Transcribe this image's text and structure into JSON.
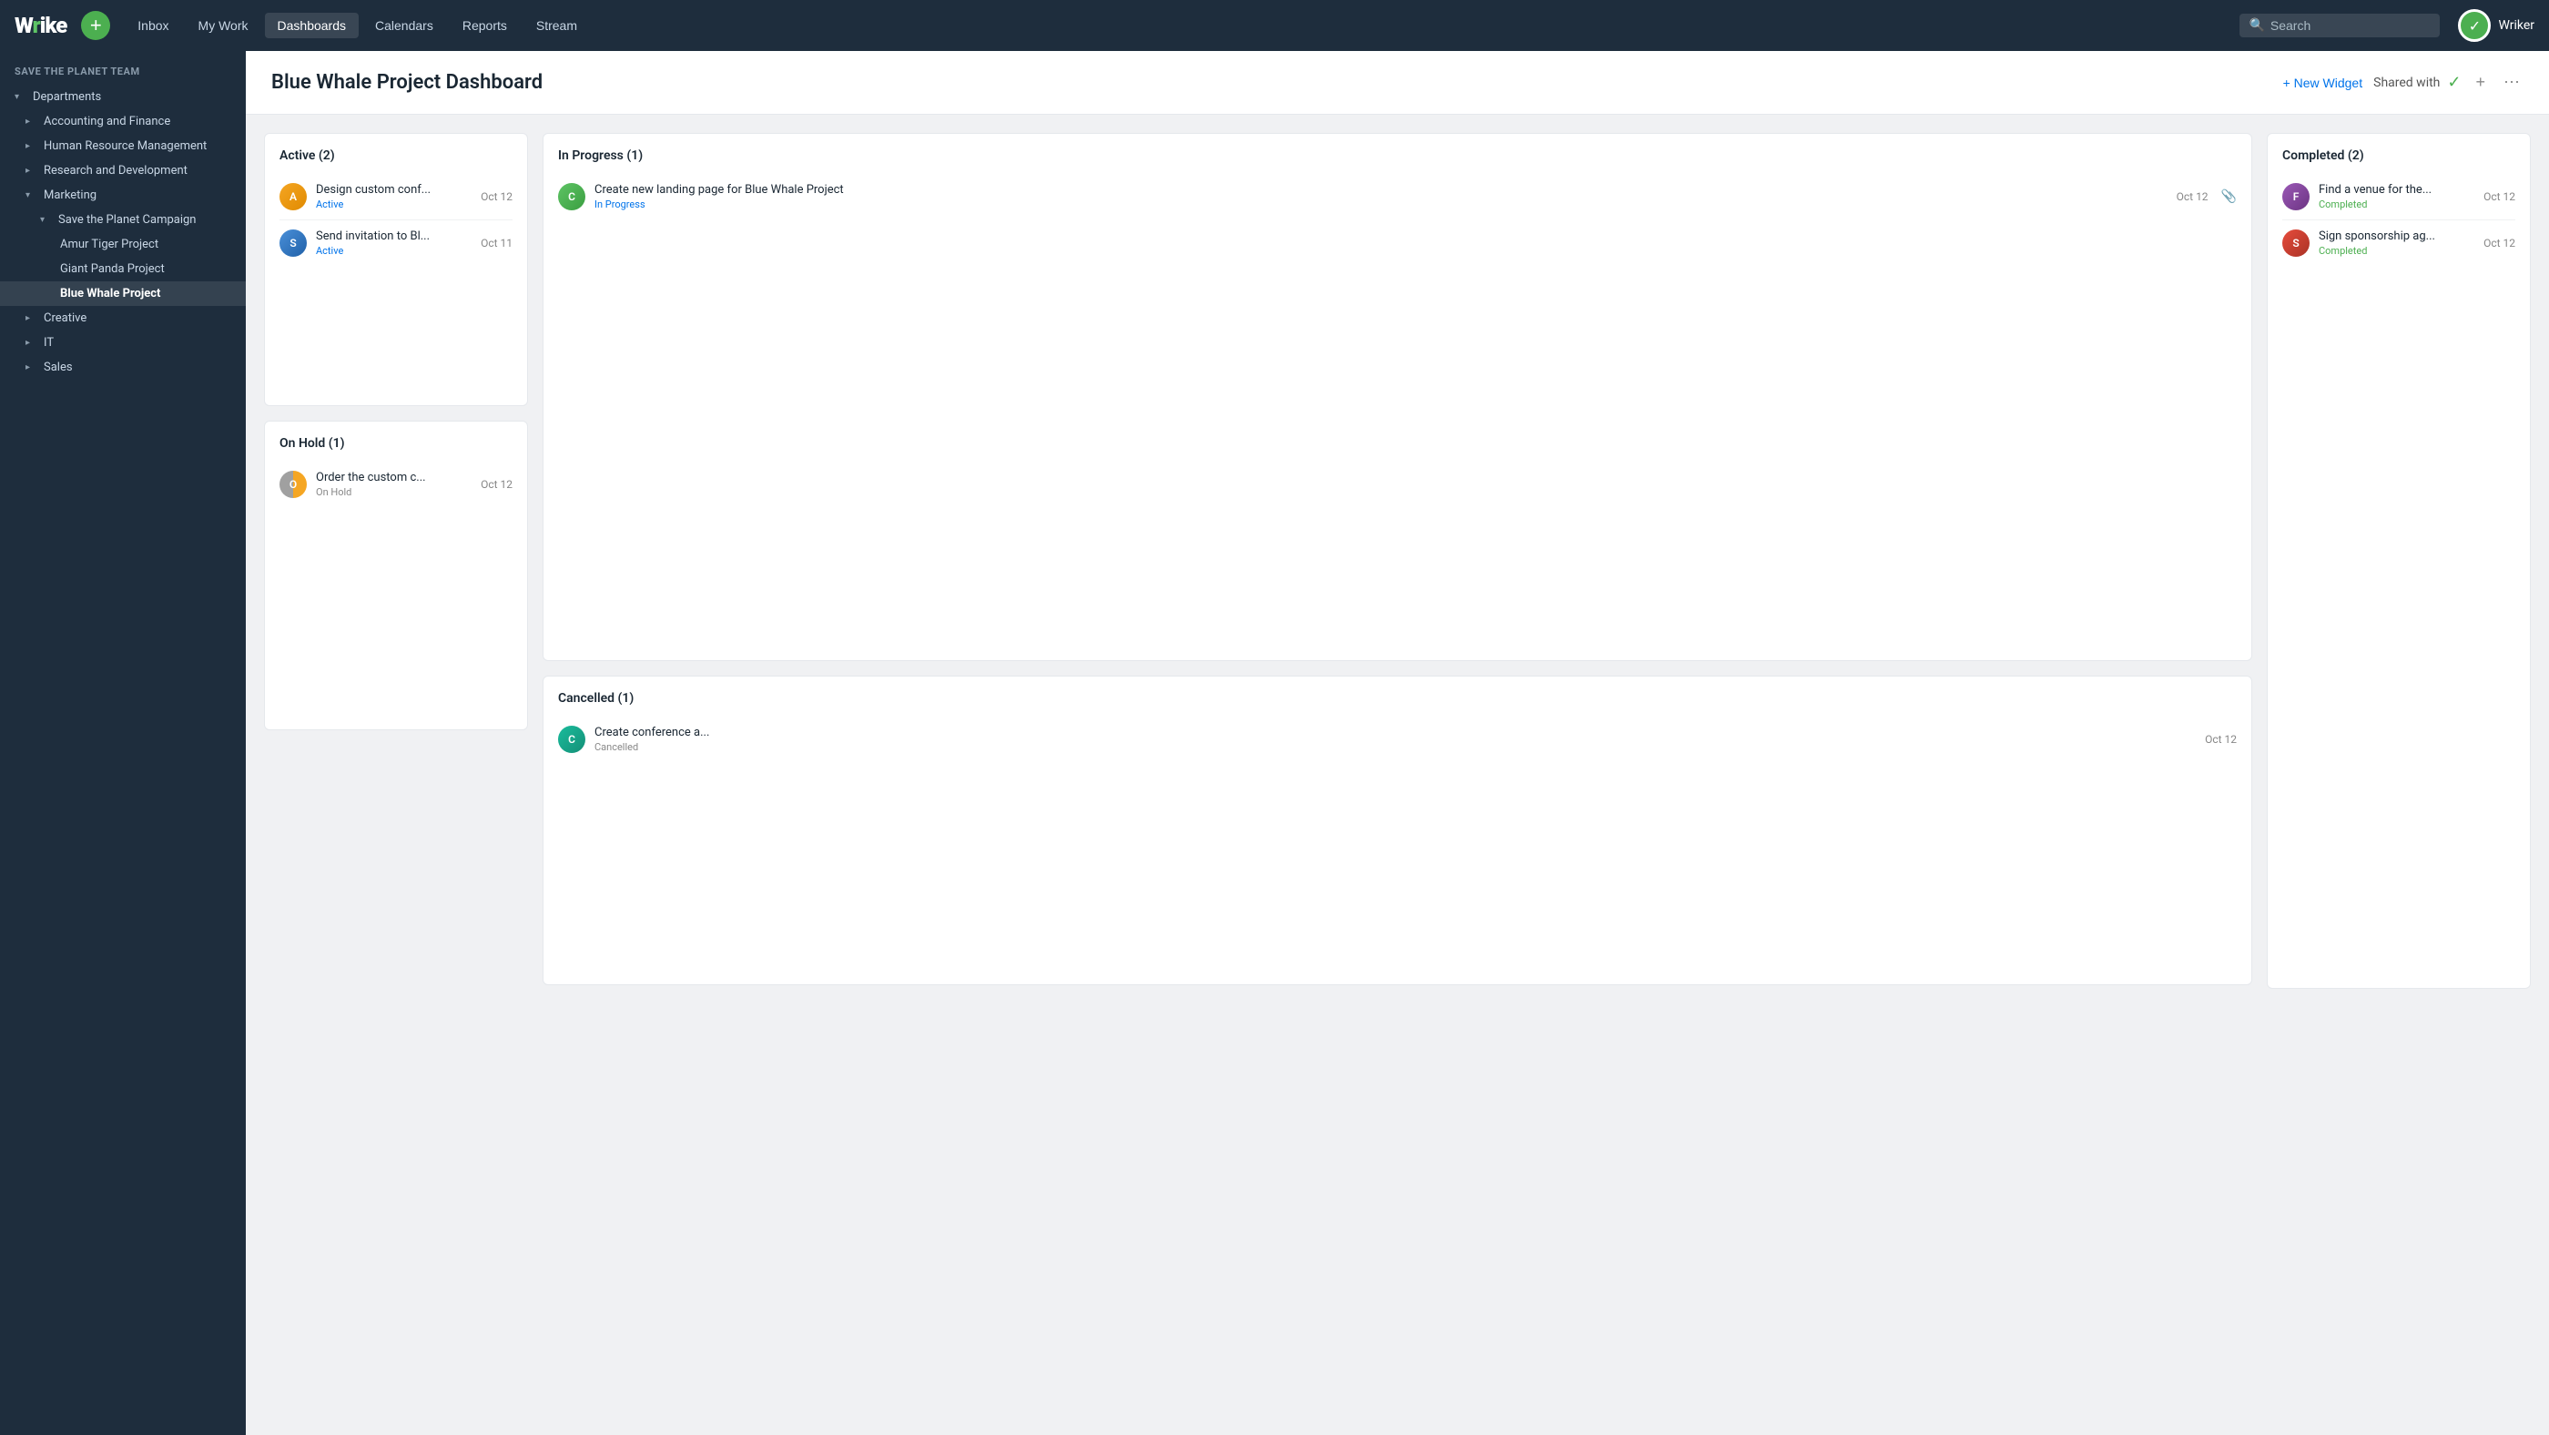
{
  "app": {
    "logo_text": "Wrike",
    "logo_mark": "✓"
  },
  "topnav": {
    "add_label": "+",
    "links": [
      "Inbox",
      "My Work",
      "Dashboards",
      "Calendars",
      "Reports",
      "Stream"
    ],
    "search_placeholder": "Search",
    "user_name": "Wriker"
  },
  "sidebar": {
    "team_label": "SAVE THE PLANET TEAM",
    "items": [
      {
        "id": "departments",
        "label": "Departments",
        "level": 0,
        "expanded": true,
        "chevron": "▾"
      },
      {
        "id": "accounting",
        "label": "Accounting and Finance",
        "level": 1,
        "expanded": false,
        "chevron": "▸"
      },
      {
        "id": "hr",
        "label": "Human Resource Management",
        "level": 1,
        "expanded": false,
        "chevron": "▸"
      },
      {
        "id": "research",
        "label": "Research and Development",
        "level": 1,
        "expanded": false,
        "chevron": "▸"
      },
      {
        "id": "marketing",
        "label": "Marketing",
        "level": 1,
        "expanded": true,
        "chevron": "▾"
      },
      {
        "id": "save-planet",
        "label": "Save the Planet Campaign",
        "level": 2,
        "expanded": true,
        "chevron": "▾"
      },
      {
        "id": "amur",
        "label": "Amur Tiger Project",
        "level": 3,
        "expanded": false,
        "chevron": ""
      },
      {
        "id": "panda",
        "label": "Giant Panda Project",
        "level": 3,
        "expanded": false,
        "chevron": ""
      },
      {
        "id": "bluewhale",
        "label": "Blue Whale Project",
        "level": 3,
        "expanded": false,
        "chevron": "",
        "active": true
      },
      {
        "id": "creative",
        "label": "Creative",
        "level": 1,
        "expanded": false,
        "chevron": "▸"
      },
      {
        "id": "it",
        "label": "IT",
        "level": 1,
        "expanded": false,
        "chevron": "▸"
      },
      {
        "id": "sales",
        "label": "Sales",
        "level": 1,
        "expanded": false,
        "chevron": "▸"
      }
    ]
  },
  "page": {
    "title": "Blue Whale Project Dashboard",
    "new_widget_label": "+ New Widget",
    "shared_with_label": "Shared with"
  },
  "widgets": {
    "active": {
      "title": "Active (2)",
      "tasks": [
        {
          "id": "t1",
          "name": "Design custom conf...",
          "status": "Active",
          "date": "Oct 12",
          "avatar_type": "orange"
        },
        {
          "id": "t2",
          "name": "Send invitation to Bl...",
          "status": "Active",
          "date": "Oct 11",
          "avatar_type": "blue"
        }
      ]
    },
    "inprogress": {
      "title": "In Progress (1)",
      "tasks": [
        {
          "id": "t3",
          "name": "Create new landing page for Blue Whale Project",
          "status": "In Progress",
          "date": "Oct 12",
          "avatar_type": "green",
          "has_clip": true
        }
      ]
    },
    "completed": {
      "title": "Completed (2)",
      "tasks": [
        {
          "id": "t4",
          "name": "Find a venue for the...",
          "status": "Completed",
          "date": "Oct 12",
          "avatar_type": "purple"
        },
        {
          "id": "t5",
          "name": "Sign sponsorship ag...",
          "status": "Completed",
          "date": "Oct 12",
          "avatar_type": "red"
        }
      ]
    },
    "onhold": {
      "title": "On Hold (1)",
      "tasks": [
        {
          "id": "t6",
          "name": "Order the custom c...",
          "status": "On Hold",
          "date": "Oct 12",
          "avatar_type": "half"
        }
      ]
    },
    "cancelled": {
      "title": "Cancelled (1)",
      "tasks": [
        {
          "id": "t7",
          "name": "Create conference a...",
          "status": "Cancelled",
          "date": "Oct 12",
          "avatar_type": "teal"
        }
      ]
    }
  }
}
